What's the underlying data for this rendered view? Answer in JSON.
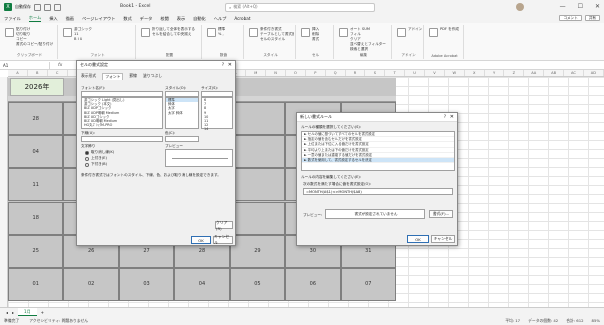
{
  "titlebar": {
    "autosave_label": "自動保存",
    "title": "Book1 - Excel",
    "search_placeholder": "検索 (Alt+Q)",
    "minimize": "—",
    "maximize": "☐",
    "close": "✕"
  },
  "menu": {
    "tabs": [
      "ファイル",
      "ホーム",
      "挿入",
      "描画",
      "ページレイアウト",
      "数式",
      "データ",
      "校閲",
      "表示",
      "自動化",
      "ヘルプ",
      "Acrobat"
    ],
    "active_index": 1,
    "comment_button": "コメント",
    "share_button": "共有"
  },
  "ribbon": {
    "groups": [
      {
        "label": "クリップボード",
        "items": [
          "貼り付け",
          "切り取り",
          "コピー",
          "書式のコピー/貼り付け"
        ]
      },
      {
        "label": "フォント",
        "items": [
          "游ゴシック",
          "11",
          "B  I  U"
        ]
      },
      {
        "label": "配置",
        "items": [
          "折り返して全体を表示する",
          "セルを結合して中央揃え"
        ]
      },
      {
        "label": "数値",
        "items": [
          "標準",
          "% ,"
        ]
      },
      {
        "label": "スタイル",
        "items": [
          "条件付き書式",
          "テーブルとして書式設定",
          "セルのスタイル"
        ]
      },
      {
        "label": "セル",
        "items": [
          "挿入",
          "削除",
          "書式"
        ]
      },
      {
        "label": "編集",
        "items": [
          "オート SUM",
          "フィル",
          "クリア",
          "並べ替えとフィルター",
          "検索と選択"
        ]
      },
      {
        "label": "アドイン",
        "items": [
          "アドイン"
        ]
      },
      {
        "label": "Adobe Acrobat",
        "items": [
          "PDF を作成"
        ]
      }
    ]
  },
  "formulabar": {
    "name_box": "A1",
    "fx": "fx"
  },
  "columns": [
    "A",
    "B",
    "C",
    "D",
    "E",
    "F",
    "G",
    "H",
    "I",
    "J",
    "K",
    "L",
    "M",
    "N",
    "O",
    "P",
    "Q",
    "R",
    "S",
    "T",
    "U",
    "V",
    "W",
    "X",
    "Y",
    "Z",
    "AA",
    "AB",
    "AC",
    "AD"
  ],
  "calendar": {
    "year": "2026年",
    "rows": [
      [
        "28",
        "",
        "",
        "",
        "",
        "",
        ""
      ],
      [
        "04",
        "",
        "",
        "",
        "",
        "",
        ""
      ],
      [
        "11",
        "",
        "",
        "",
        "",
        "",
        ""
      ],
      [
        "18",
        "",
        "",
        "",
        "",
        "",
        ""
      ],
      [
        "25",
        "26",
        "27",
        "28",
        "29",
        "30",
        "31"
      ],
      [
        "01",
        "02",
        "03",
        "04",
        "05",
        "06",
        "07"
      ]
    ]
  },
  "sheet": {
    "tab_label": "1月",
    "add_label": "+"
  },
  "status": {
    "left": "準備完了",
    "accessibility": "アクセシビリティ: 問題ありません",
    "right_items": [
      "平均: 17",
      "データの個数: 42",
      "合計: 612"
    ],
    "zoom": "85%"
  },
  "format_dialog": {
    "title": "セルの書式設定",
    "help": "?",
    "close": "✕",
    "tabs": [
      "表示形式",
      "フォント",
      "罫線",
      "塗りつぶし"
    ],
    "active_tab": 1,
    "font_label": "フォント名(F):",
    "style_label": "スタイル(O):",
    "size_label": "サイズ(S):",
    "fonts": [
      "游ゴシック Light (見出し)",
      "游ゴシック (本文)",
      "BIZ UDPゴシック",
      "BIZ UDP明朝 Medium",
      "BIZ UDゴシック",
      "BIZ UD明朝 Medium",
      "HG丸ｺﾞｼｯｸM-PRO"
    ],
    "styles": [
      "標準",
      "斜体",
      "太字",
      "太字 斜体"
    ],
    "sizes": [
      "6",
      "7",
      "8",
      "9",
      "10",
      "11",
      "12",
      "14"
    ],
    "underline_label": "下線(U):",
    "color_label": "色(C):",
    "effects_label": "文字飾り",
    "effects": [
      "取り消し線(K)",
      "上付き(E)",
      "下付き(B)"
    ],
    "preview_label": "プレビュー",
    "note": "条件付き書式ではフォントのスタイル、下線、色、および取り消し線を設定できます。",
    "clear_button": "クリア(R)",
    "ok": "OK",
    "cancel": "キャンセル"
  },
  "rule_dialog": {
    "title": "新しい書式ルール",
    "help": "?",
    "close": "✕",
    "select_label": "ルールの種類を選択してください(S):",
    "rule_types": [
      "► セルの値に基づいてすべてのセルを書式設定",
      "► 指定の値を含むセルだけを書式設定",
      "► 上位または下位に入る値だけを書式設定",
      "► 平均より上または下の値だけを書式設定",
      "► 一意の値または重複する値だけを書式設定",
      "► 数式を使用して、書式設定するセルを決定"
    ],
    "selected_index": 5,
    "edit_label": "ルールの内容を編集してください(E):",
    "formula_label": "次の数式を満たす場合に値を書式設定(O):",
    "formula": "=MONTH(A$1)<>MONTH($A8)",
    "preview_label": "プレビュー:",
    "preview_text": "書式が設定されていません",
    "format_button": "書式(F)...",
    "ok": "OK",
    "cancel": "キャンセル"
  }
}
